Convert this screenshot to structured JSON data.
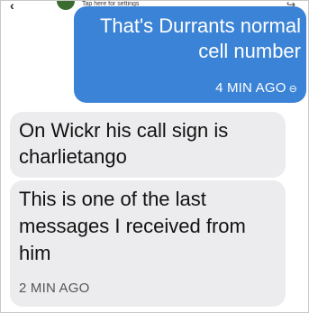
{
  "header": {
    "back_icon": "chevron-left-icon",
    "settings_hint": "Tap here for settings",
    "call_icon": "phone-icon"
  },
  "messages": [
    {
      "direction": "outgoing",
      "text": "That's Durrants normal cell number",
      "timestamp": "4 MIN AGO",
      "status_icon": "link-icon",
      "color": "#3b83d6"
    },
    {
      "direction": "incoming",
      "text": "On Wickr his call sign is charlietango",
      "color": "#ececee"
    },
    {
      "direction": "incoming",
      "text": "This is one of the last messages I received from him",
      "timestamp": "2 MIN AGO",
      "color": "#ececee"
    }
  ]
}
